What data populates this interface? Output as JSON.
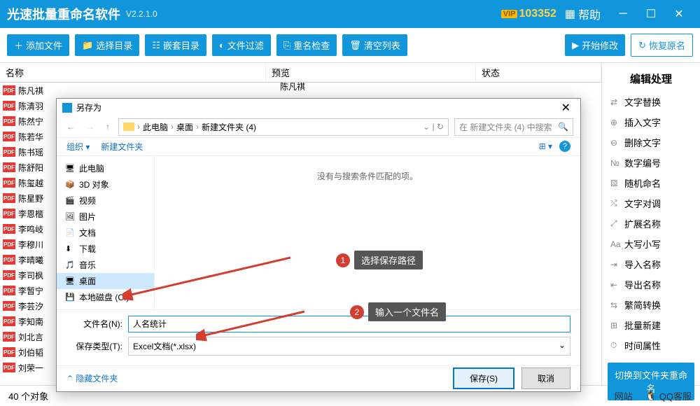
{
  "titlebar": {
    "title": "光速批量重命名软件",
    "version": "V2.2.1.0",
    "vip": "103352",
    "help": "帮助"
  },
  "toolbar": {
    "add": "添加文件",
    "dir": "选择目录",
    "nest": "嵌套目录",
    "filter": "文件过滤",
    "check": "重名检查",
    "clear": "清空列表",
    "start": "开始修改",
    "restore": "恢复原名"
  },
  "columns": {
    "name": "名称",
    "preview": "预览",
    "status": "状态"
  },
  "preview_first": "陈凡祺",
  "files": [
    "陈凡祺",
    "陈清羽",
    "陈然宁",
    "陈若华",
    "陈书瑶",
    "陈舒阳",
    "陈玺越",
    "陈星野",
    "李恩楷",
    "李鸣岐",
    "李穆川",
    "李晴曦",
    "李司枫",
    "李暂宁",
    "李芸汐",
    "李知南",
    "刘北言",
    "刘伯韬",
    "刘荣一"
  ],
  "sidebar": {
    "title": "编辑处理",
    "items": [
      "文字替换",
      "插入文字",
      "删除文字",
      "数字编号",
      "随机命名",
      "文字对调",
      "扩展名称",
      "大写小写",
      "导入名称",
      "导出名称",
      "繁简转换",
      "批量新建",
      "时间属性"
    ],
    "switch": "切换到文件夹重命名"
  },
  "statusbar": {
    "count": "40 个对象",
    "site": "网站",
    "qq": "QQ客服"
  },
  "dialog": {
    "title": "另存为",
    "crumbs": [
      "此电脑",
      "桌面",
      "新建文件夹 (4)"
    ],
    "search_ph": "在 新建文件夹 (4) 中搜索",
    "organize": "组织",
    "newfolder": "新建文件夹",
    "empty": "没有与搜索条件匹配的项。",
    "tree": [
      {
        "label": "此电脑",
        "icon": "🖥"
      },
      {
        "label": "3D 对象",
        "icon": "📦"
      },
      {
        "label": "视频",
        "icon": "🎬"
      },
      {
        "label": "图片",
        "icon": "🖼"
      },
      {
        "label": "文档",
        "icon": "📄"
      },
      {
        "label": "下载",
        "icon": "⬇"
      },
      {
        "label": "音乐",
        "icon": "🎵"
      },
      {
        "label": "桌面",
        "icon": "🖥",
        "sel": true
      },
      {
        "label": "本地磁盘 (C:)",
        "icon": "💾"
      }
    ],
    "filename_label": "文件名(N):",
    "filename": "人名统计",
    "type_label": "保存类型(T):",
    "type": "Excel文档(*.xlsx)",
    "hide": "隐藏文件夹",
    "save": "保存(S)",
    "cancel": "取消"
  },
  "anno": {
    "a1": "选择保存路径",
    "a2": "输入一个文件名"
  }
}
